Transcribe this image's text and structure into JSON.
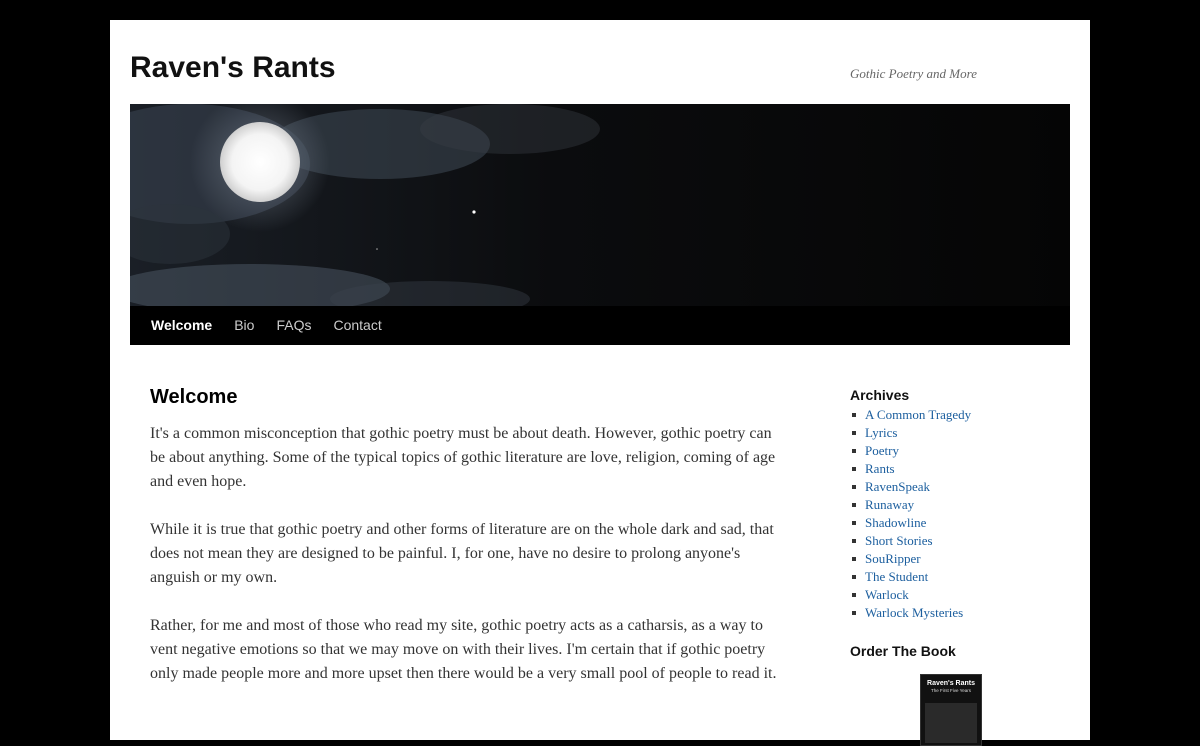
{
  "site": {
    "title": "Raven's Rants",
    "description": "Gothic Poetry and More"
  },
  "nav": {
    "items": [
      {
        "label": "Welcome",
        "current": true
      },
      {
        "label": "Bio",
        "current": false
      },
      {
        "label": "FAQs",
        "current": false
      },
      {
        "label": "Contact",
        "current": false
      }
    ]
  },
  "page": {
    "title": "Welcome",
    "paragraphs": [
      "It's a common misconception that gothic poetry must be about death. However, gothic poetry can be about anything. Some of the typical topics of gothic literature are love, religion, coming of age and even hope.",
      "While it is true that gothic poetry and other forms of literature are on the whole dark and sad, that does not mean they are designed to be painful. I, for one, have no desire to prolong anyone's anguish or my own.",
      "Rather, for me and most of those who read my site, gothic poetry acts as a catharsis, as a way to vent negative emotions so that we may move on with their lives. I'm certain that if gothic poetry only made people more and more upset then there would be a very small pool of people to read it."
    ]
  },
  "sidebar": {
    "archives_title": "Archives",
    "archives": [
      "A Common Tragedy",
      "Lyrics",
      "Poetry",
      "Rants",
      "RavenSpeak",
      "Runaway",
      "Shadowline",
      "Short Stories",
      "SouRipper",
      "The Student",
      "Warlock",
      "Warlock Mysteries"
    ],
    "book_title": "Order The Book",
    "book_cover_title": "Raven's Rants",
    "book_cover_subtitle": "The First Five Years"
  },
  "colors": {
    "link": "#1b5e9e",
    "nav_bg": "#000000",
    "page_bg": "#000000"
  }
}
